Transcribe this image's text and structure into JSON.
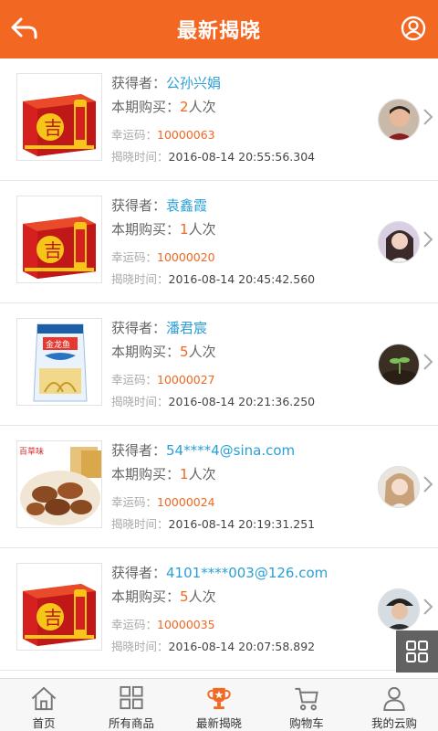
{
  "header": {
    "title": "最新揭晓"
  },
  "labels": {
    "winner": "获得者：",
    "purchase": "本期购买：",
    "lucky": "幸运码：",
    "time": "揭晓时间："
  },
  "items": [
    {
      "winner": "公孙兴娟",
      "count": "2",
      "unit": "人次",
      "code": "10000063",
      "time": "2016-08-14 20:55:56.304",
      "product": "wanglaoji-box",
      "avatar": "man-portrait"
    },
    {
      "winner": "袁鑫霞",
      "count": "1",
      "unit": "人次",
      "code": "10000020",
      "time": "2016-08-14 20:45:42.560",
      "product": "wanglaoji-box",
      "avatar": "woman-portrait"
    },
    {
      "winner": "潘君宸",
      "count": "5",
      "unit": "人次",
      "code": "10000027",
      "time": "2016-08-14 20:21:36.250",
      "product": "rice-bag",
      "avatar": "sprout"
    },
    {
      "winner": "54****4@sina.com",
      "count": "1",
      "unit": "人次",
      "code": "10000024",
      "time": "2016-08-14 20:19:31.251",
      "product": "pecan-nuts",
      "avatar": "girl-portrait"
    },
    {
      "winner": "4101****003@126.com",
      "count": "5",
      "unit": "人次",
      "code": "10000035",
      "time": "2016-08-14 20:07:58.892",
      "product": "wanglaoji-box",
      "avatar": "man-cap-portrait"
    }
  ],
  "nav": [
    {
      "label": "首页",
      "icon": "home-icon"
    },
    {
      "label": "所有商品",
      "icon": "grid-icon"
    },
    {
      "label": "最新揭晓",
      "icon": "trophy-icon"
    },
    {
      "label": "购物车",
      "icon": "cart-icon"
    },
    {
      "label": "我的云购",
      "icon": "person-icon"
    }
  ],
  "colors": {
    "accent": "#f26722",
    "link": "#2a9fd6"
  }
}
